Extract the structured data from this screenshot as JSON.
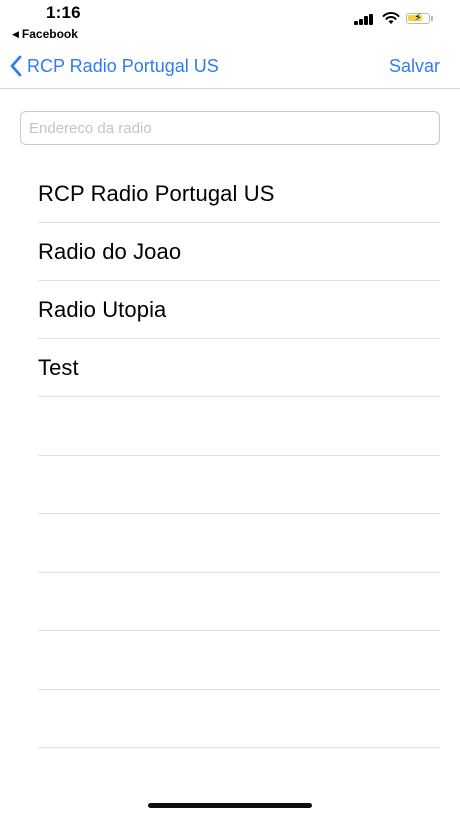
{
  "status_bar": {
    "time": "1:16",
    "back_app": "Facebook",
    "back_app_icon": "back-triangle-icon",
    "signal_icon": "cellular-signal-icon",
    "wifi_icon": "wifi-icon",
    "battery_icon": "battery-charging-icon",
    "battery_color": "#f5d33b"
  },
  "nav": {
    "back_label": "RCP Radio Portugal US",
    "back_icon": "chevron-left-icon",
    "save_label": "Salvar",
    "accent": "#2f7bf0"
  },
  "address": {
    "placeholder": "Endereco da radio",
    "value": ""
  },
  "stations": [
    {
      "name": "RCP Radio Portugal US"
    },
    {
      "name": "Radio do Joao"
    },
    {
      "name": "Radio Utopia"
    },
    {
      "name": "Test"
    }
  ]
}
